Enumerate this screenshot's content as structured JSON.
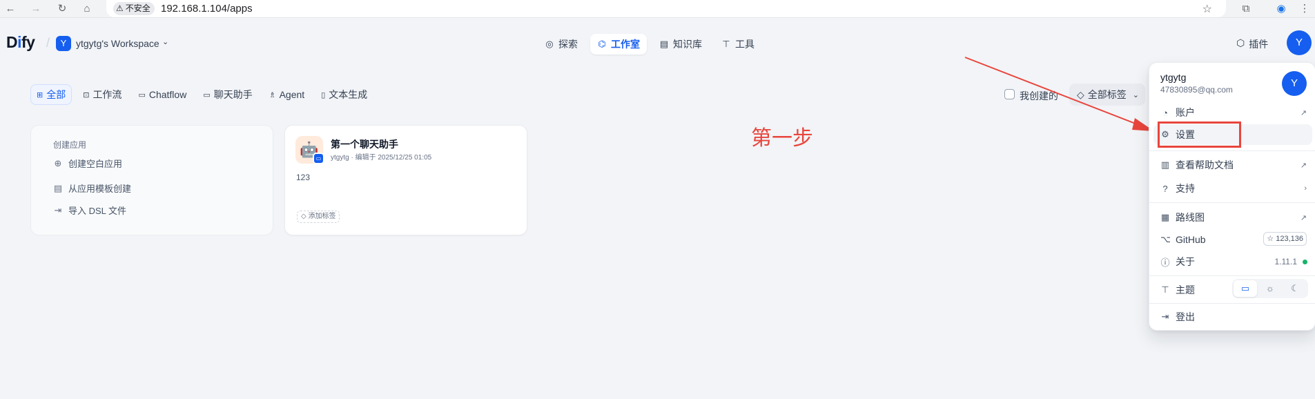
{
  "browser": {
    "security_label": "不安全",
    "url": "192.168.1.104/apps"
  },
  "header": {
    "logo_d": "D",
    "logo_i": "i",
    "logo_rest": "fy",
    "workspace_badge": "Y",
    "workspace_name": "ytgytg's Workspace",
    "nav": [
      {
        "label": "探索",
        "icon": "compass-icon"
      },
      {
        "label": "工作室",
        "icon": "robot-icon"
      },
      {
        "label": "知识库",
        "icon": "book-icon"
      },
      {
        "label": "工具",
        "icon": "hammer-icon"
      }
    ],
    "plugin_label": "插件",
    "avatar_letter": "Y"
  },
  "tabs": [
    {
      "label": "全部",
      "active": true
    },
    {
      "label": "工作流"
    },
    {
      "label": "Chatflow"
    },
    {
      "label": "聊天助手"
    },
    {
      "label": "Agent"
    },
    {
      "label": "文本生成"
    }
  ],
  "filters": {
    "mine_label": "我创建的",
    "tags_label": "全部标签"
  },
  "create_card": {
    "title": "创建应用",
    "items": [
      "创建空白应用",
      "从应用模板创建",
      "导入 DSL 文件"
    ]
  },
  "app_card": {
    "name": "第一个聊天助手",
    "meta": "ytgytg · 编辑于 2025/12/25 01:05",
    "description": "123",
    "add_tag": "添加标签"
  },
  "annotation": {
    "step_text": "第一步",
    "color": "#e8453c"
  },
  "menu": {
    "username": "ytgytg",
    "email": "47830895@qq.com",
    "avatar_letter": "Y",
    "account": "账户",
    "settings": "设置",
    "help_docs": "查看帮助文档",
    "support": "支持",
    "roadmap": "路线图",
    "github": "GitHub",
    "github_stars": "☆ 123,136",
    "about": "关于",
    "version": "1.11.1",
    "theme": "主题",
    "logout": "登出"
  },
  "colors": {
    "accent": "#155eef",
    "status_green": "#17b26a"
  }
}
